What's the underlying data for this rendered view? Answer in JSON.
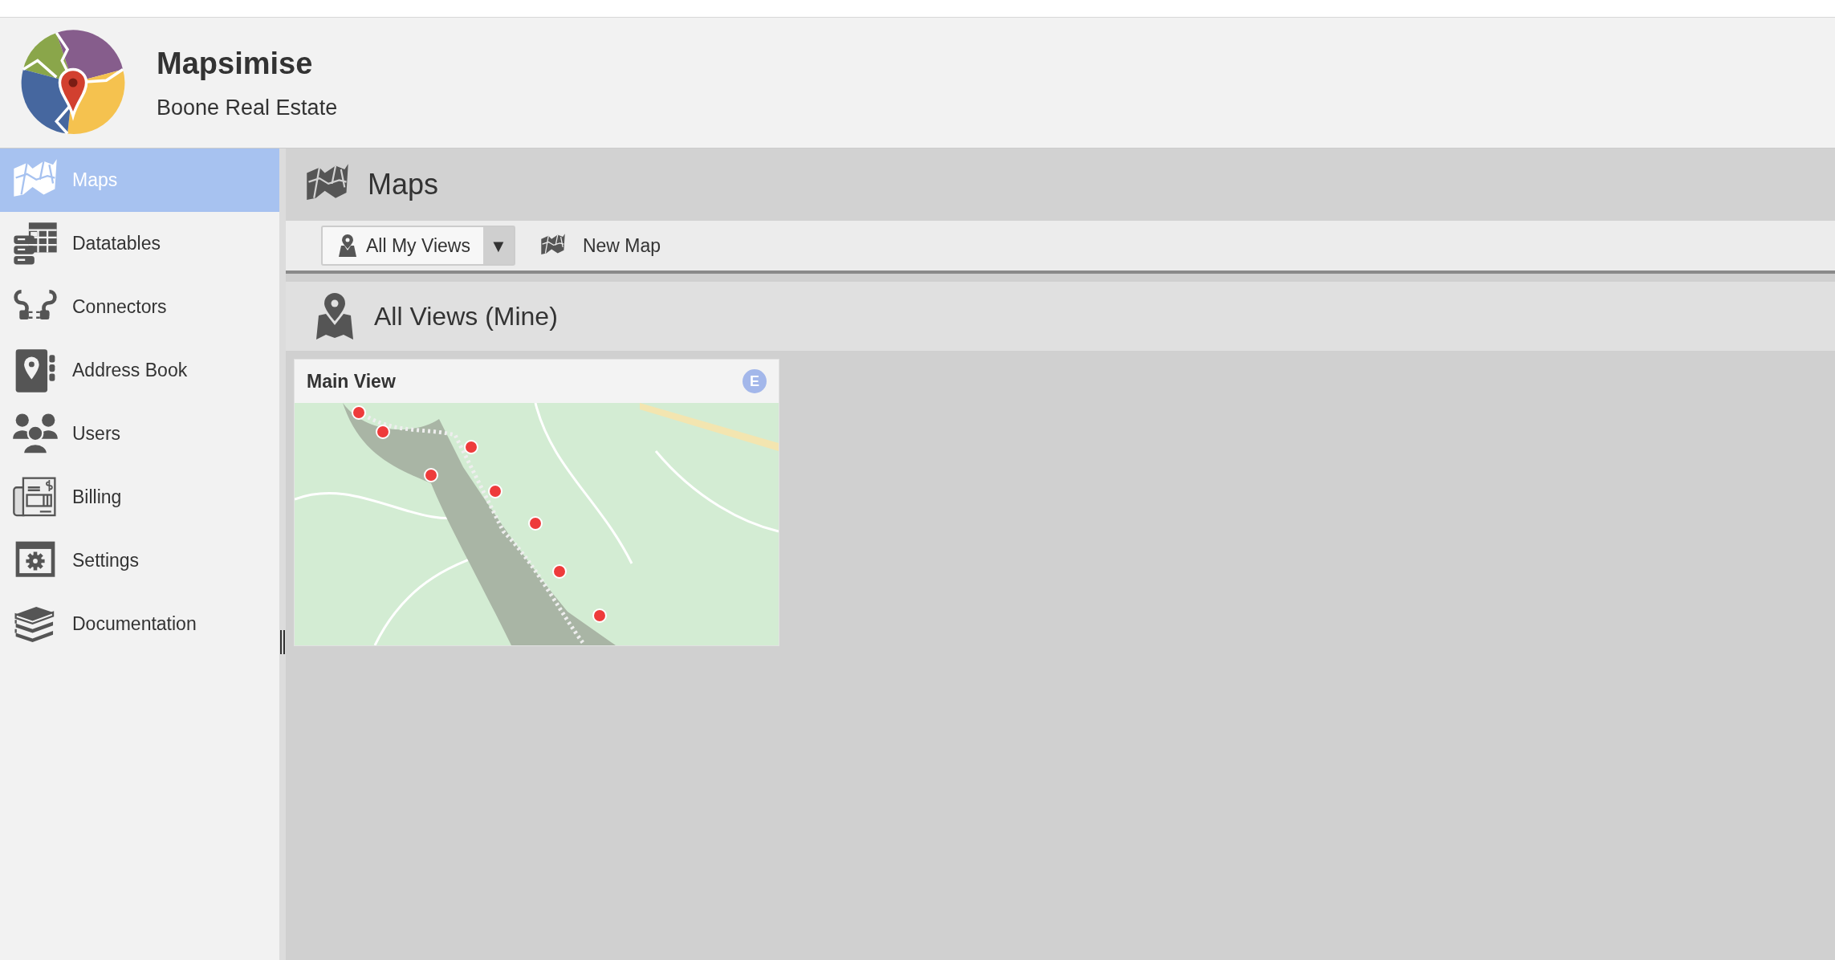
{
  "header": {
    "app_name": "Mapsimise",
    "organization": "Boone Real Estate"
  },
  "sidebar": {
    "items": [
      {
        "label": "Maps",
        "selected": true
      },
      {
        "label": "Datatables",
        "selected": false
      },
      {
        "label": "Connectors",
        "selected": false
      },
      {
        "label": "Address Book",
        "selected": false
      },
      {
        "label": "Users",
        "selected": false
      },
      {
        "label": "Billing",
        "selected": false
      },
      {
        "label": "Settings",
        "selected": false
      },
      {
        "label": "Documentation",
        "selected": false
      }
    ]
  },
  "page": {
    "title": "Maps",
    "toolbar": {
      "view_dropdown": {
        "value": "All My Views",
        "arrow": "▼"
      },
      "new_map_button": "New Map"
    },
    "section": {
      "title": "All Views (Mine)",
      "cards": [
        {
          "title": "Main View",
          "badge": "E",
          "kind": "picture"
        }
      ]
    }
  }
}
